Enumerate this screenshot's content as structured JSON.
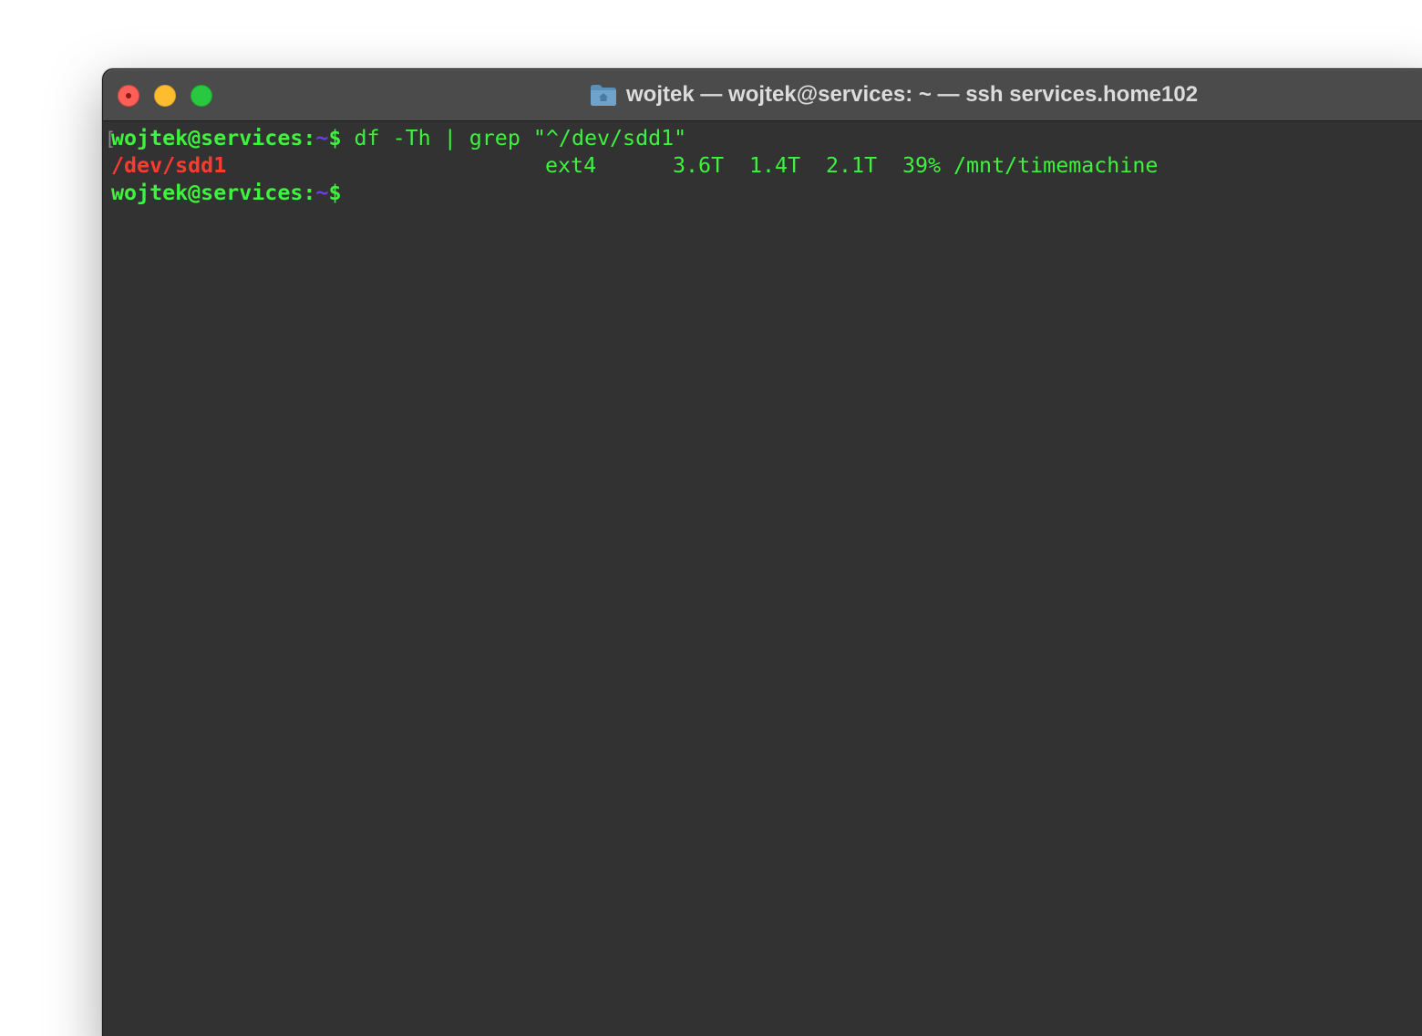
{
  "window": {
    "title": "wojtek — wojtek@services: ~ — ssh services.home102"
  },
  "icons": {
    "title_icon": "folder-home-icon",
    "close": "close-button",
    "minimize": "minimize-button",
    "maximize": "zoom-button"
  },
  "colors": {
    "terminal_bg": "#323232",
    "prompt_green": "#3ef23e",
    "path_purple": "#6b3cf0",
    "device_red": "#ff3b30"
  },
  "terminal": {
    "line1": {
      "bracket": "[",
      "user_host": "wojtek@services:",
      "path": "~",
      "dollar": "$",
      "command": " df -Th | grep \"^/dev/sdd1\""
    },
    "line2": {
      "device": "/dev/sdd1",
      "fstype": "ext4",
      "size": "3.6T",
      "used": "1.4T",
      "avail": "2.1T",
      "use_percent": "39%",
      "mount": "/mnt/timemachine"
    },
    "line3": {
      "user_host": "wojtek@services:",
      "path": "~",
      "dollar": "$"
    }
  }
}
